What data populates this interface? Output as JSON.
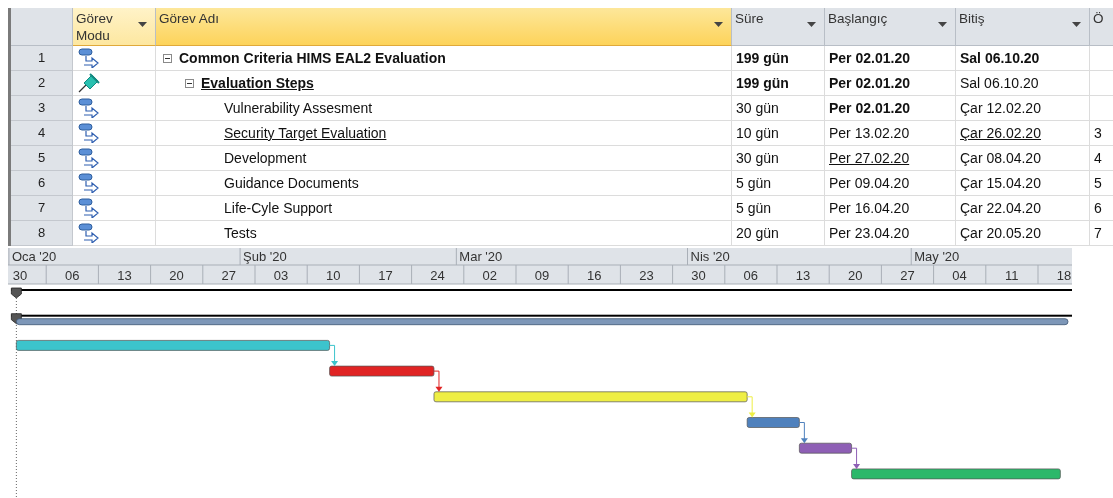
{
  "table": {
    "columns": [
      {
        "label": "Görev Modu",
        "selected": true,
        "dropdown": true
      },
      {
        "label": "Görev Adı",
        "selected": true,
        "dropdown": true
      },
      {
        "label": "Süre",
        "selected": false,
        "dropdown": true
      },
      {
        "label": "Başlangıç",
        "selected": false,
        "dropdown": true
      },
      {
        "label": "Bitiş",
        "selected": false,
        "dropdown": true
      },
      {
        "label": "Ö",
        "selected": false,
        "dropdown": false
      }
    ],
    "tasks": [
      {
        "id": "1",
        "kind": "project-summary",
        "expanded": true,
        "name": {
          "text": "Common Criteria HIMS EAL2 Evaluation",
          "bold": true,
          "underlined": false
        },
        "duration": {
          "text": "199 gün",
          "bold": true,
          "underlined": false
        },
        "start": {
          "text": "Per 02.01.20",
          "bold": true,
          "underlined": false
        },
        "finish": {
          "text": "Sal 06.10.20",
          "bold": true,
          "underlined": false
        },
        "children": [
          {
            "id": "2",
            "kind": "manual-summary",
            "expanded": true,
            "name": {
              "text": "Evaluation Steps",
              "bold": true,
              "underlined": true
            },
            "duration": {
              "text": "199 gün",
              "bold": true,
              "underlined": false
            },
            "start": {
              "text": "Per 02.01.20",
              "bold": true,
              "underlined": false
            },
            "finish": {
              "text": "Sal 06.10.20",
              "bold": false,
              "underlined": false
            },
            "children": [
              {
                "id": "3",
                "kind": "task",
                "color": "#3cc4cc",
                "name": {
                  "text": "Vulnerability Assesment",
                  "bold": false,
                  "underlined": false
                },
                "duration": {
                  "text": "30 gün",
                  "bold": false,
                  "underlined": false
                },
                "start": {
                  "text": "Per 02.01.20",
                  "bold": true,
                  "underlined": false
                },
                "finish": {
                  "text": "Çar 12.02.20",
                  "bold": false,
                  "underlined": false
                }
              },
              {
                "id": "4",
                "kind": "task",
                "color": "#e02424",
                "name": {
                  "text": "Security Target Evaluation",
                  "bold": false,
                  "underlined": true
                },
                "duration": {
                  "text": "10 gün",
                  "bold": false,
                  "underlined": false
                },
                "start": {
                  "text": "Per 13.02.20",
                  "bold": false,
                  "underlined": false
                },
                "finish": {
                  "text": "Çar 26.02.20",
                  "bold": false,
                  "underlined": true
                },
                "predecessors": "3"
              },
              {
                "id": "5",
                "kind": "task",
                "color": "#eeee44",
                "name": {
                  "text": "Development",
                  "bold": false,
                  "underlined": false
                },
                "duration": {
                  "text": "30 gün",
                  "bold": false,
                  "underlined": false
                },
                "start": {
                  "text": "Per 27.02.20",
                  "bold": false,
                  "underlined": true
                },
                "finish": {
                  "text": "Çar 08.04.20",
                  "bold": false,
                  "underlined": false
                },
                "predecessors": "4"
              },
              {
                "id": "6",
                "kind": "task",
                "color": "#4f81bd",
                "name": {
                  "text": "Guidance Documents",
                  "bold": false,
                  "underlined": false
                },
                "duration": {
                  "text": "5 gün",
                  "bold": false,
                  "underlined": false
                },
                "start": {
                  "text": "Per 09.04.20",
                  "bold": false,
                  "underlined": false
                },
                "finish": {
                  "text": "Çar 15.04.20",
                  "bold": false,
                  "underlined": false
                },
                "predecessors": "5"
              },
              {
                "id": "7",
                "kind": "task",
                "color": "#8e5fb5",
                "name": {
                  "text": "Life-Cyle Support",
                  "bold": false,
                  "underlined": false
                },
                "duration": {
                  "text": "5 gün",
                  "bold": false,
                  "underlined": false
                },
                "start": {
                  "text": "Per 16.04.20",
                  "bold": false,
                  "underlined": false
                },
                "finish": {
                  "text": "Çar 22.04.20",
                  "bold": false,
                  "underlined": false
                },
                "predecessors": "6"
              },
              {
                "id": "8",
                "kind": "task",
                "color": "#2cb86a",
                "name": {
                  "text": "Tests",
                  "bold": false,
                  "underlined": false
                },
                "duration": {
                  "text": "20 gün",
                  "bold": false,
                  "underlined": false
                },
                "start": {
                  "text": "Per 23.04.20",
                  "bold": false,
                  "underlined": false
                },
                "finish": {
                  "text": "Çar 20.05.20",
                  "bold": false,
                  "underlined": false
                },
                "predecessors": "7"
              }
            ]
          }
        ]
      }
    ]
  },
  "timescale": {
    "months": [
      "Oca '20",
      "Şub '20",
      "Mar '20",
      "Nis '20",
      "May '20"
    ],
    "weeks": [
      "30",
      "06",
      "13",
      "20",
      "27",
      "03",
      "10",
      "17",
      "24",
      "02",
      "09",
      "16",
      "23",
      "30",
      "06",
      "13",
      "20",
      "27",
      "04",
      "11",
      "18"
    ]
  }
}
